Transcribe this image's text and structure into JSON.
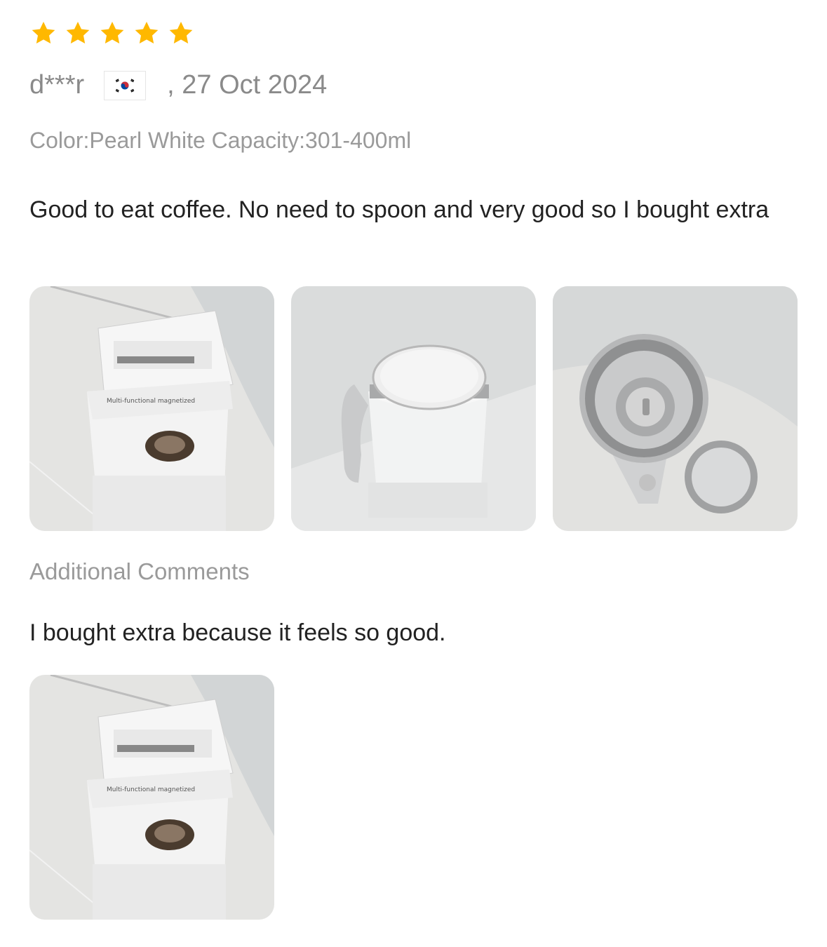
{
  "review": {
    "rating": 5,
    "reviewer": "d***r",
    "date": ", 27 Oct 2024",
    "flag_icon": "south-korea-flag-icon",
    "sku": "Color:Pearl White Capacity:301-400ml",
    "body": "Good to eat coffee. No need to spoon and very good so I bought extra",
    "photos": [
      "box-photo",
      "mug-closed-photo",
      "mug-open-photo"
    ]
  },
  "additional": {
    "heading": "Additional Comments",
    "body": "I bought extra because it feels so good.",
    "photos": [
      "box-photo"
    ]
  },
  "colors": {
    "star": "#FFB800",
    "muted": "#8a8a8a",
    "text": "#222222"
  }
}
